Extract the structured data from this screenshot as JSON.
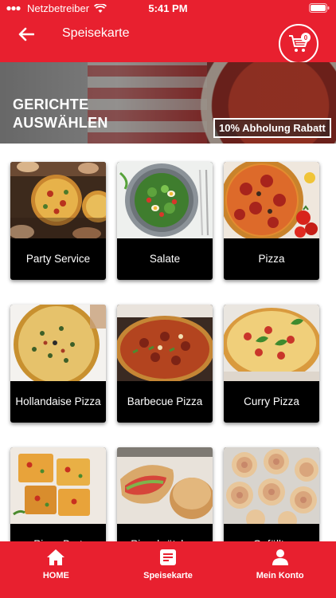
{
  "status_bar": {
    "carrier": "Netzbetreiber",
    "time": "5:41 PM"
  },
  "appbar": {
    "title": "Speisekarte",
    "cart_count": "0"
  },
  "hero": {
    "title_line1": "GERICHTE",
    "title_line2": "AUSWÄHLEN",
    "promo": "10% Abholung Rabatt"
  },
  "menu": {
    "items": [
      {
        "label": "Party Service"
      },
      {
        "label": "Salate"
      },
      {
        "label": "Pizza"
      },
      {
        "label": "Hollandaise Pizza"
      },
      {
        "label": "Barbecue Pizza"
      },
      {
        "label": "Curry Pizza"
      },
      {
        "label": "Pizza Brot"
      },
      {
        "label": "Pizzabrötchen"
      },
      {
        "label": "Gefüllte"
      }
    ]
  },
  "tabbar": {
    "home": "HOME",
    "menu": "Speisekarte",
    "account": "Mein Konto"
  },
  "colors": {
    "brand_red": "#e8202f",
    "card_black": "#000000"
  }
}
